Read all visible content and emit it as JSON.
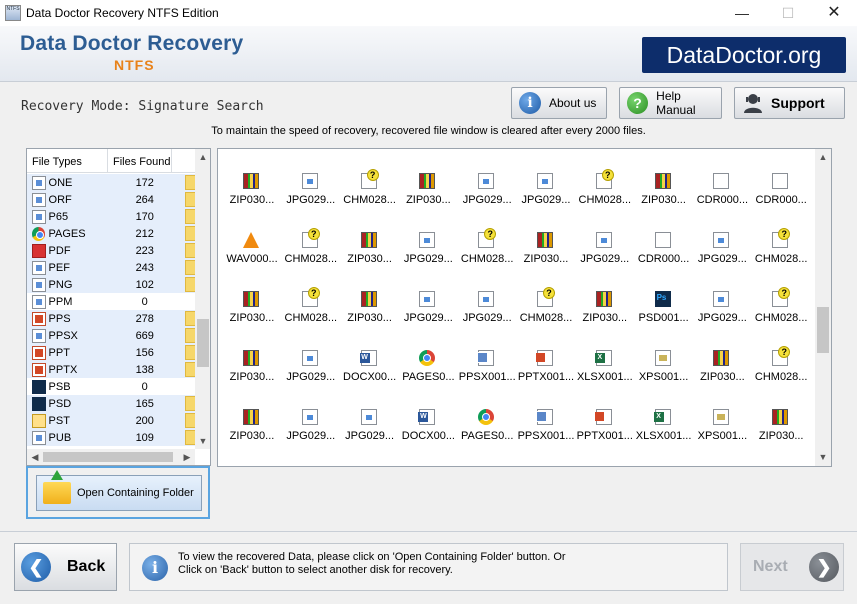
{
  "window": {
    "title": "Data Doctor Recovery NTFS Edition",
    "icon_text": "NTFS",
    "controls": {
      "minimize": "—",
      "maximize": "☐",
      "close": "✕"
    }
  },
  "banner": {
    "title": "Data Doctor Recovery",
    "subtitle": "NTFS",
    "logo": "DataDoctor.org",
    "colors": {
      "title": "#2d5d93",
      "subtitle": "#e8821a",
      "logo_bg": "#0d2d6b"
    }
  },
  "mode": {
    "label": "Recovery Mode: Signature Search"
  },
  "toolbar": {
    "about_label": "About us",
    "about_icon": "info-icon",
    "manual_label": "Help Manual",
    "manual_icon": "help-icon",
    "support_label": "Support",
    "support_icon": "user-icon"
  },
  "notice": "To maintain the speed of recovery, recovered file window is cleared after every 2000 files.",
  "file_types": {
    "headers": [
      "File Types",
      "Files Found"
    ],
    "rows": [
      {
        "name": "ONE",
        "count": "172",
        "icon": "doc"
      },
      {
        "name": "ORF",
        "count": "264",
        "icon": "doc"
      },
      {
        "name": "P65",
        "count": "170",
        "icon": "doc"
      },
      {
        "name": "PAGES",
        "count": "212",
        "icon": "chrome"
      },
      {
        "name": "PDF",
        "count": "223",
        "icon": "pdf"
      },
      {
        "name": "PEF",
        "count": "243",
        "icon": "doc"
      },
      {
        "name": "PNG",
        "count": "102",
        "icon": "doc"
      },
      {
        "name": "PPM",
        "count": "0",
        "icon": "doc"
      },
      {
        "name": "PPS",
        "count": "278",
        "icon": "ppt"
      },
      {
        "name": "PPSX",
        "count": "669",
        "icon": "doc"
      },
      {
        "name": "PPT",
        "count": "156",
        "icon": "ppt"
      },
      {
        "name": "PPTX",
        "count": "138",
        "icon": "ppt"
      },
      {
        "name": "PSB",
        "count": "0",
        "icon": "ps"
      },
      {
        "name": "PSD",
        "count": "165",
        "icon": "ps"
      },
      {
        "name": "PST",
        "count": "200",
        "icon": "pst"
      },
      {
        "name": "PUB",
        "count": "109",
        "icon": "doc"
      }
    ]
  },
  "open_folder": {
    "label": "Open Containing Folder",
    "icon": "folder-icon"
  },
  "files": [
    [
      {
        "label": "ZIP030...",
        "icon": "zip"
      },
      {
        "label": "JPG029...",
        "icon": "jpg"
      },
      {
        "label": "CHM028...",
        "icon": "chm"
      },
      {
        "label": "ZIP030...",
        "icon": "zip"
      },
      {
        "label": "JPG029...",
        "icon": "jpg"
      },
      {
        "label": "JPG029...",
        "icon": "jpg"
      },
      {
        "label": "CHM028...",
        "icon": "chm"
      },
      {
        "label": "ZIP030...",
        "icon": "zip"
      },
      {
        "label": "CDR000...",
        "icon": "cdr"
      },
      {
        "label": "CDR000...",
        "icon": "cdr"
      }
    ],
    [
      {
        "label": "WAV000...",
        "icon": "wav"
      },
      {
        "label": "CHM028...",
        "icon": "chm"
      },
      {
        "label": "ZIP030...",
        "icon": "zip"
      },
      {
        "label": "JPG029...",
        "icon": "jpg"
      },
      {
        "label": "CHM028...",
        "icon": "chm"
      },
      {
        "label": "ZIP030...",
        "icon": "zip"
      },
      {
        "label": "JPG029...",
        "icon": "jpg"
      },
      {
        "label": "CDR000...",
        "icon": "cdr"
      },
      {
        "label": "JPG029...",
        "icon": "jpg"
      },
      {
        "label": "CHM028...",
        "icon": "chm"
      }
    ],
    [
      {
        "label": "ZIP030...",
        "icon": "zip"
      },
      {
        "label": "CHM028...",
        "icon": "chm"
      },
      {
        "label": "ZIP030...",
        "icon": "zip"
      },
      {
        "label": "JPG029...",
        "icon": "jpg"
      },
      {
        "label": "JPG029...",
        "icon": "jpg"
      },
      {
        "label": "CHM028...",
        "icon": "chm"
      },
      {
        "label": "ZIP030...",
        "icon": "zip"
      },
      {
        "label": "PSD001...",
        "icon": "psd"
      },
      {
        "label": "JPG029...",
        "icon": "jpg"
      },
      {
        "label": "CHM028...",
        "icon": "chm"
      }
    ],
    [
      {
        "label": "ZIP030...",
        "icon": "zip"
      },
      {
        "label": "JPG029...",
        "icon": "jpg"
      },
      {
        "label": "DOCX00...",
        "icon": "docx"
      },
      {
        "label": "PAGES0...",
        "icon": "pages"
      },
      {
        "label": "PPSX001...",
        "icon": "ppsx"
      },
      {
        "label": "PPTX001...",
        "icon": "pptx"
      },
      {
        "label": "XLSX001...",
        "icon": "xlsx"
      },
      {
        "label": "XPS001...",
        "icon": "xps"
      },
      {
        "label": "ZIP030...",
        "icon": "zip"
      },
      {
        "label": "CHM028...",
        "icon": "chm"
      }
    ],
    [
      {
        "label": "ZIP030...",
        "icon": "zip"
      },
      {
        "label": "JPG029...",
        "icon": "jpg"
      },
      {
        "label": "JPG029...",
        "icon": "jpg"
      },
      {
        "label": "DOCX00...",
        "icon": "docx"
      },
      {
        "label": "PAGES0...",
        "icon": "pages"
      },
      {
        "label": "PPSX001...",
        "icon": "ppsx"
      },
      {
        "label": "PPTX001...",
        "icon": "pptx"
      },
      {
        "label": "XLSX001...",
        "icon": "xlsx"
      },
      {
        "label": "XPS001...",
        "icon": "xps"
      },
      {
        "label": "ZIP030...",
        "icon": "zip"
      }
    ]
  ],
  "footer": {
    "back_label": "Back",
    "back_icon": "arrow-left-icon",
    "info_line1": "To view the recovered Data, please click on 'Open Containing Folder' button. Or",
    "info_line2": "Click on 'Back' button to select another disk for recovery.",
    "info_icon": "info-icon",
    "next_label": "Next",
    "next_icon": "arrow-right-icon"
  }
}
